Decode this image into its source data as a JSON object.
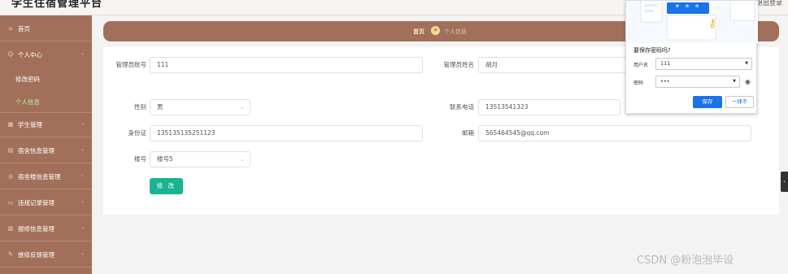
{
  "header": {
    "app_title": "学生住宿管理平台",
    "logout": "退出登录"
  },
  "sidebar": {
    "items": [
      {
        "label": "首页",
        "icon": "home-icon",
        "has_chevron": false
      },
      {
        "label": "个人中心",
        "icon": "user-icon",
        "has_chevron": true
      },
      {
        "label": "学生管理",
        "icon": "grid-icon",
        "has_chevron": true
      },
      {
        "label": "宿舍信息管理",
        "icon": "building-icon",
        "has_chevron": true
      },
      {
        "label": "宿舍楼信息管理",
        "icon": "location-icon",
        "has_chevron": true
      },
      {
        "label": "违规记录管理",
        "icon": "doc-icon",
        "has_chevron": true
      },
      {
        "label": "报修信息管理",
        "icon": "chart-icon",
        "has_chevron": true
      },
      {
        "label": "维修反馈管理",
        "icon": "tool-icon",
        "has_chevron": true
      }
    ],
    "sub_items": [
      {
        "label": "修改密码",
        "active": false
      },
      {
        "label": "个人信息",
        "active": true
      }
    ],
    "chevron": "⌄"
  },
  "breadcrumb": {
    "home": "首页",
    "current": "个人信息",
    "icon": "star-icon"
  },
  "form": {
    "account_label": "管理员账号",
    "account_value": "111",
    "name_label": "管理员姓名",
    "name_value": "胡月",
    "gender_label": "性别",
    "gender_value": "男",
    "phone_label": "联系电话",
    "phone_value": "13513541323",
    "idcard_label": "身份证",
    "idcard_value": "135135135251123",
    "email_label": "邮箱",
    "email_value": "565464545@qq.com",
    "building_label": "楼号",
    "building_value": "楼号5",
    "submit_label": "修 改"
  },
  "password_popup": {
    "stars": "* * *",
    "title": "要保存密码吗?",
    "username_label": "用户名",
    "username_value": "111",
    "password_label": "密码",
    "password_value": "•••",
    "save_label": "保存",
    "never_label": "一律不",
    "accent": "#1a73e8"
  },
  "watermark": "CSDN @粉泡泡毕设",
  "colors": {
    "sidebar": "#a2705a",
    "submit": "#1ab394",
    "active_sub": "#b6f0a2"
  }
}
